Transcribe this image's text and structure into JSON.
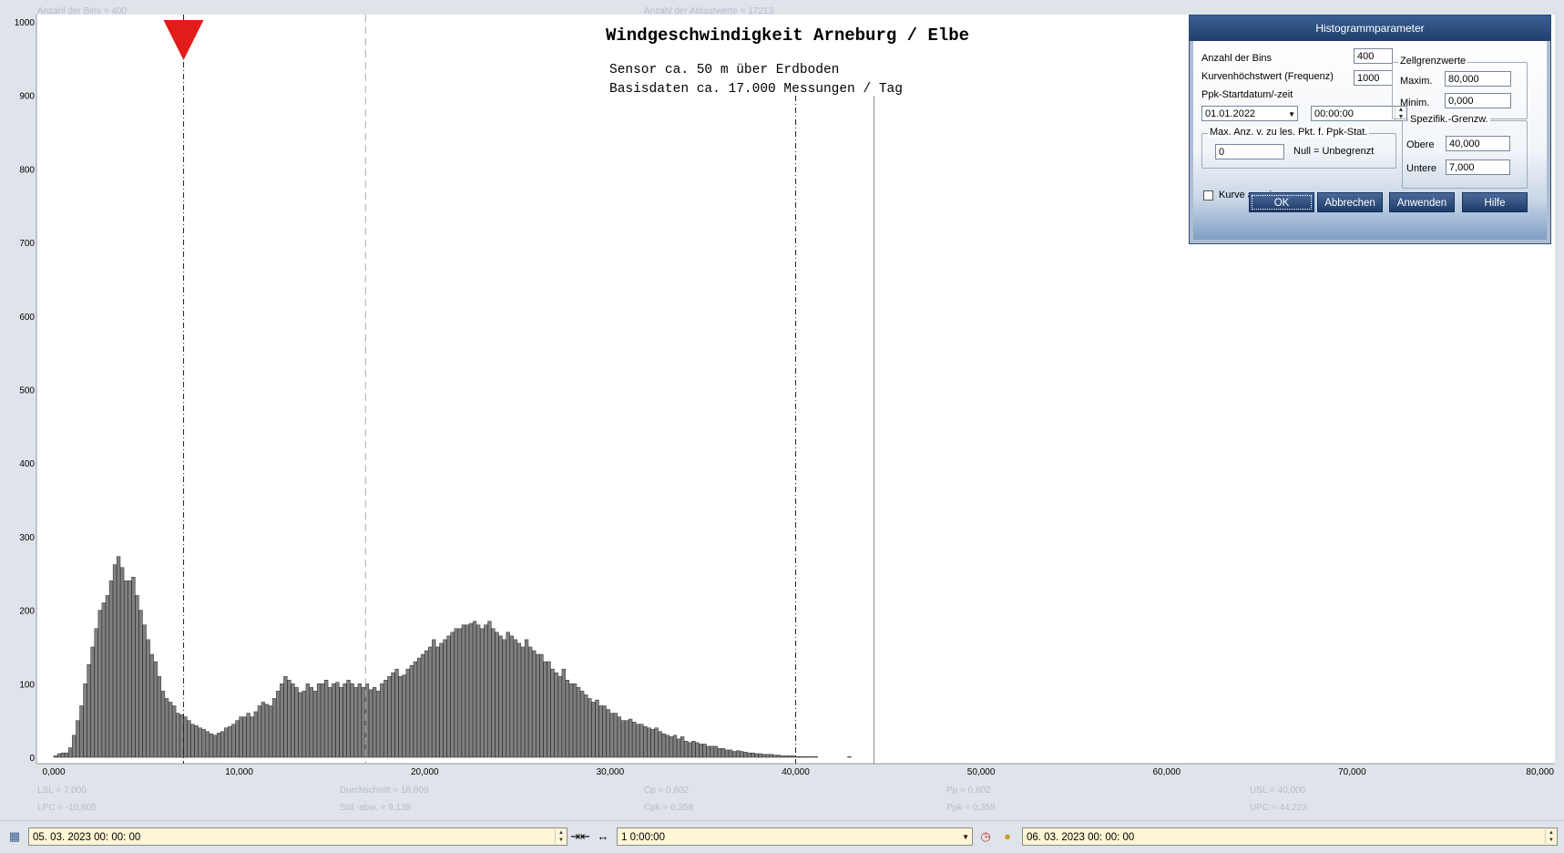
{
  "chart_data": {
    "type": "bar",
    "title": "Windgeschwindigkeit  Arneburg / Elbe",
    "subtitle": [
      "Sensor ca. 50 m über Erdboden",
      "Basisdaten ca. 17.000 Messungen / Tag"
    ],
    "header_left": "Anzahl der Bins = 400",
    "header_center": "Anzahl der Abtastwerte = 17213",
    "xlim": [
      0,
      80
    ],
    "ylim": [
      0,
      1000
    ],
    "x_ticks": [
      "0,000",
      "10,000",
      "20,000",
      "30,000",
      "40,000",
      "50,000",
      "60,000",
      "70,000",
      "80,000"
    ],
    "y_ticks": [
      "0",
      "100",
      "200",
      "300",
      "400",
      "500",
      "600",
      "700",
      "800",
      "900",
      "1000"
    ],
    "bin_width": 0.2,
    "bins_start": 0,
    "values": [
      2,
      5,
      6,
      6,
      13,
      30,
      50,
      70,
      100,
      126,
      150,
      175,
      200,
      210,
      220,
      240,
      262,
      273,
      258,
      240,
      240,
      245,
      220,
      200,
      180,
      160,
      140,
      130,
      110,
      90,
      80,
      75,
      70,
      60,
      58,
      55,
      50,
      45,
      43,
      40,
      38,
      35,
      32,
      30,
      33,
      35,
      40,
      42,
      45,
      50,
      55,
      55,
      60,
      55,
      62,
      70,
      75,
      72,
      70,
      80,
      90,
      100,
      110,
      105,
      100,
      95,
      88,
      90,
      100,
      95,
      90,
      100,
      100,
      105,
      95,
      100,
      102,
      95,
      100,
      105,
      100,
      95,
      100,
      95,
      100,
      92,
      95,
      90,
      100,
      105,
      110,
      115,
      120,
      110,
      112,
      120,
      125,
      130,
      135,
      140,
      145,
      150,
      160,
      150,
      155,
      160,
      165,
      170,
      175,
      175,
      180,
      180,
      182,
      185,
      180,
      175,
      180,
      185,
      175,
      170,
      165,
      160,
      170,
      165,
      160,
      155,
      150,
      160,
      150,
      145,
      140,
      140,
      130,
      130,
      120,
      115,
      110,
      120,
      105,
      100,
      100,
      95,
      90,
      85,
      80,
      75,
      78,
      70,
      70,
      65,
      60,
      60,
      55,
      50,
      50,
      52,
      48,
      45,
      45,
      42,
      40,
      38,
      40,
      35,
      32,
      30,
      28,
      30,
      25,
      28,
      22,
      20,
      22,
      20,
      18,
      18,
      15,
      15,
      15,
      12,
      12,
      10,
      10,
      8,
      9,
      8,
      7,
      6,
      6,
      5,
      5,
      4,
      4,
      4,
      3,
      3,
      2,
      2,
      2,
      2,
      1,
      1,
      1,
      1,
      1,
      1,
      0,
      0,
      0,
      0,
      0,
      0,
      0,
      0,
      1
    ],
    "lines": [
      {
        "name": "LSL",
        "x": 7.0,
        "style": "dashdot"
      },
      {
        "name": "Durchschnitt",
        "x": 16.809,
        "style": "dashed-gray"
      },
      {
        "name": "USL",
        "x": 40.0,
        "style": "dashdot"
      },
      {
        "name": "UPC",
        "x": 44.223,
        "style": "solid-gray"
      }
    ],
    "stats": {
      "lsl": "LSL = 7,000",
      "lpc": "LPC = -10,605",
      "mean": "Durchschnitt = 16,809",
      "stddev": "Std.-abw. = 9,138",
      "cp": "Cp = 0,602",
      "cpk": "Cpk = 0,358",
      "pp": "Pp = 0,602",
      "ppk": "Ppk = 0,358",
      "usl": "USL = 40,000",
      "upc": "UPC = 44,223"
    },
    "bar_color": "#808080",
    "marker_color": "#e21b1b"
  },
  "dialog": {
    "title": "Histogrammparameter",
    "bins_label": "Anzahl der Bins",
    "bins_value": "400",
    "curve_max_label": "Kurvenhöchstwert (Frequenz)",
    "curve_max_value": "1000",
    "ppk_start_label": "Ppk-Startdatum/-zeit",
    "ppk_date": "01.01.2022",
    "ppk_time": "00:00:00",
    "cell_limits_title": "Zellgrenzwerte",
    "max_label": "Maxim.",
    "max_value": "80,000",
    "min_label": "Minim.",
    "min_value": "0,000",
    "maxpts_title": "Max. Anz. v. zu les. Pkt. f. Ppk-Stat.",
    "maxpts_value": "0",
    "maxpts_hint": "Null = Unbegrenzt",
    "spec_title": "Spezifik.-Grenzw.",
    "upper_label": "Obere",
    "upper_value": "40,000",
    "lower_label": "Untere",
    "lower_value": "7,000",
    "show_curve_label": "Kurve anzeigen",
    "show_curve_checked": false,
    "ok_label": "OK",
    "cancel_label": "Abbrechen",
    "apply_label": "Anwenden",
    "help_label": "Hilfe"
  },
  "bottom_bar": {
    "start_datetime": "05. 03. 2023   00: 00: 00",
    "interval": "1  0:00:00",
    "end_datetime": "06. 03. 2023   00: 00: 00"
  }
}
